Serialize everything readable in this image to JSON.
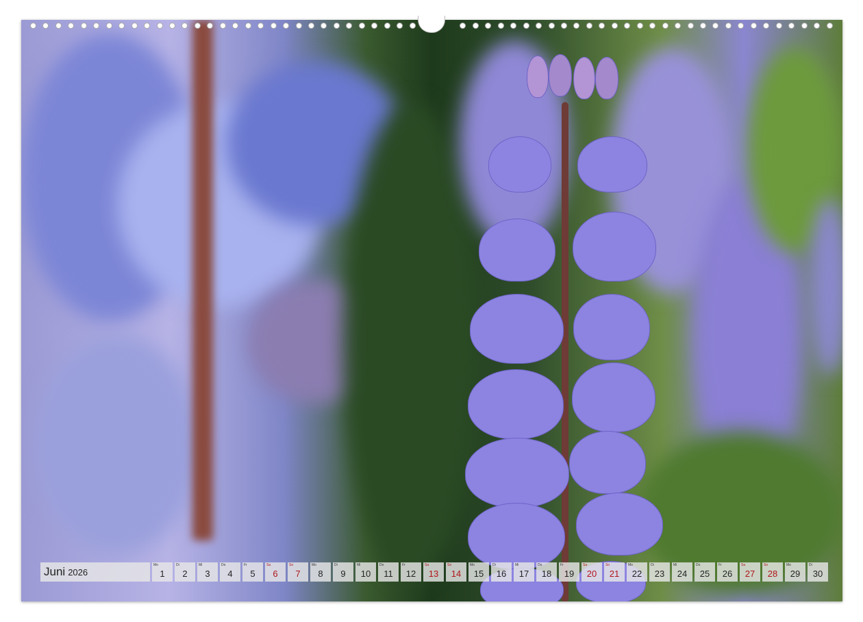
{
  "calendar": {
    "month": "Juni",
    "year": "2026",
    "days": [
      {
        "wd": "Mo",
        "num": "1",
        "red": false
      },
      {
        "wd": "Di",
        "num": "2",
        "red": false
      },
      {
        "wd": "Mi",
        "num": "3",
        "red": false
      },
      {
        "wd": "Do",
        "num": "4",
        "red": false
      },
      {
        "wd": "Fr",
        "num": "5",
        "red": false
      },
      {
        "wd": "Sa",
        "num": "6",
        "red": true
      },
      {
        "wd": "So",
        "num": "7",
        "red": true
      },
      {
        "wd": "Mo",
        "num": "8",
        "red": false
      },
      {
        "wd": "Di",
        "num": "9",
        "red": false
      },
      {
        "wd": "Mi",
        "num": "10",
        "red": false
      },
      {
        "wd": "Do",
        "num": "11",
        "red": false
      },
      {
        "wd": "Fr",
        "num": "12",
        "red": false
      },
      {
        "wd": "Sa",
        "num": "13",
        "red": true
      },
      {
        "wd": "So",
        "num": "14",
        "red": true
      },
      {
        "wd": "Mo",
        "num": "15",
        "red": false
      },
      {
        "wd": "Di",
        "num": "16",
        "red": false
      },
      {
        "wd": "Mi",
        "num": "17",
        "red": false
      },
      {
        "wd": "Do",
        "num": "18",
        "red": false
      },
      {
        "wd": "Fr",
        "num": "19",
        "red": false
      },
      {
        "wd": "Sa",
        "num": "20",
        "red": true
      },
      {
        "wd": "So",
        "num": "21",
        "red": true
      },
      {
        "wd": "Mo",
        "num": "22",
        "red": false
      },
      {
        "wd": "Di",
        "num": "23",
        "red": false
      },
      {
        "wd": "Mi",
        "num": "24",
        "red": false
      },
      {
        "wd": "Do",
        "num": "25",
        "red": false
      },
      {
        "wd": "Fr",
        "num": "26",
        "red": false
      },
      {
        "wd": "Sa",
        "num": "27",
        "red": true
      },
      {
        "wd": "So",
        "num": "28",
        "red": true
      },
      {
        "wd": "Mo",
        "num": "29",
        "red": false
      },
      {
        "wd": "Di",
        "num": "30",
        "red": false
      }
    ]
  },
  "colors": {
    "accent_red": "#b0151a",
    "flower_purple": "#8c84e0",
    "foliage_green": "#3a5a2f"
  },
  "icons": {
    "binding": "spiral-binding-holes-icon",
    "hanger": "calendar-hanger-icon"
  }
}
